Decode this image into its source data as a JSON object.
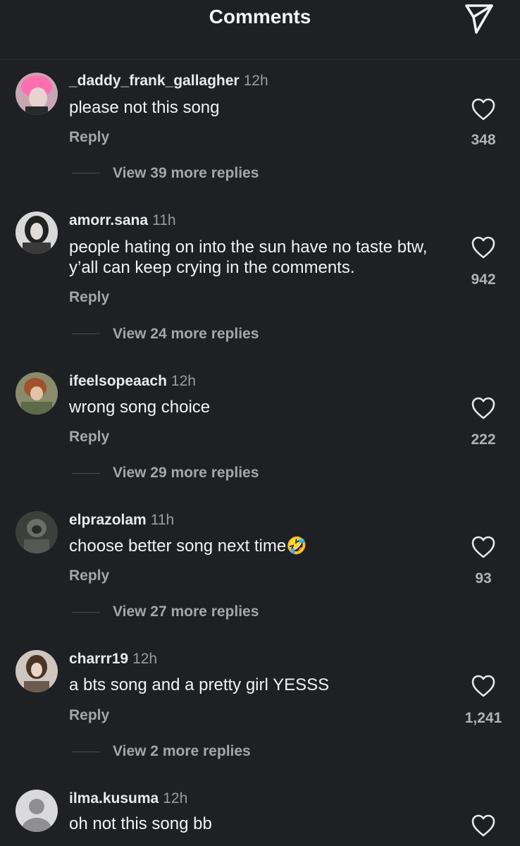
{
  "header": {
    "title": "Comments"
  },
  "comments": [
    {
      "username": "_daddy_frank_gallagher",
      "time": "12h",
      "text": "please not this song",
      "reply_label": "Reply",
      "likes": "348",
      "view_more": "View 39 more replies"
    },
    {
      "username": "amorr.sana",
      "time": "11h",
      "text": "people hating on into the sun have no taste btw, y’all can keep crying in the comments.",
      "reply_label": "Reply",
      "likes": "942",
      "view_more": "View 24 more replies"
    },
    {
      "username": "ifeelsopeaach",
      "time": "12h",
      "text": "wrong song choice",
      "reply_label": "Reply",
      "likes": "222",
      "view_more": "View 29 more replies"
    },
    {
      "username": "elprazolam",
      "time": "11h",
      "text": "choose better song next time",
      "emoji": "🤣",
      "reply_label": "Reply",
      "likes": "93",
      "view_more": "View 27 more replies"
    },
    {
      "username": "charrr19",
      "time": "12h",
      "text": "a bts song and a pretty girl YESSS",
      "reply_label": "Reply",
      "likes": "1,241",
      "view_more": "View 2 more replies"
    },
    {
      "username": "ilma.kusuma",
      "time": "12h",
      "text": "oh not this song bb"
    }
  ],
  "colors": {
    "background": "#1f2024",
    "text": "#f3f3f3",
    "muted": "#a4a6ab"
  }
}
